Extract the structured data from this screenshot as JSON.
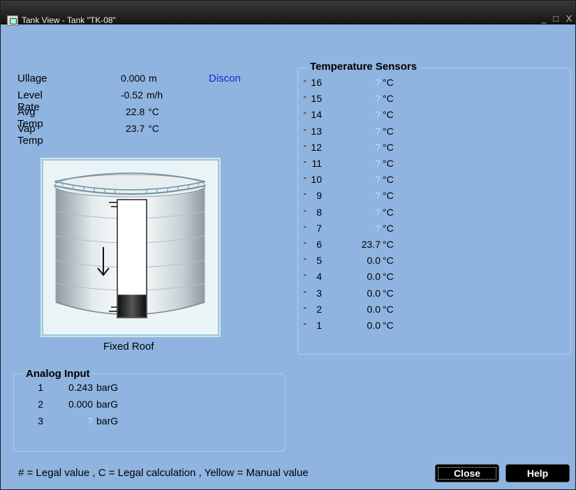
{
  "window": {
    "title": "Tank View - Tank \"TK-08\"",
    "controls": {
      "minimize": "_",
      "maximize": "□",
      "close": "X"
    }
  },
  "readouts": [
    {
      "label": "Ullage",
      "value": "0.000",
      "unit": "m"
    },
    {
      "label": "Level Rate",
      "value": "-0.52",
      "unit": "m/h"
    },
    {
      "label": "Avg Temp",
      "value": "22.8",
      "unit": "°C"
    },
    {
      "label": "Vap Temp",
      "value": "23.7",
      "unit": "°C"
    }
  ],
  "status": "Discon",
  "tank": {
    "roof_type": "Fixed Roof",
    "level_fraction": 0.19,
    "direction": "down"
  },
  "analog_input": {
    "title": "Analog Input",
    "rows": [
      {
        "index": "1",
        "value": "0.243",
        "unit": "barG"
      },
      {
        "index": "2",
        "value": "0.000",
        "unit": "barG"
      },
      {
        "index": "3",
        "value": "?",
        "unit": "barG"
      }
    ]
  },
  "temperature_sensors": {
    "title": "Temperature Sensors",
    "marker": "\"",
    "rows": [
      {
        "index": "16",
        "value": "?",
        "unit": "°C"
      },
      {
        "index": "15",
        "value": "?",
        "unit": "°C"
      },
      {
        "index": "14",
        "value": "?",
        "unit": "°C"
      },
      {
        "index": "13",
        "value": "?",
        "unit": "°C"
      },
      {
        "index": "12",
        "value": "?",
        "unit": "°C"
      },
      {
        "index": "11",
        "value": "?",
        "unit": "°C"
      },
      {
        "index": "10",
        "value": "?",
        "unit": "°C"
      },
      {
        "index": "9",
        "value": "?",
        "unit": "°C"
      },
      {
        "index": "8",
        "value": "?",
        "unit": "°C"
      },
      {
        "index": "7",
        "value": "?",
        "unit": "°C"
      },
      {
        "index": "6",
        "value": "23.7",
        "unit": "°C"
      },
      {
        "index": "5",
        "value": "0.0",
        "unit": "°C"
      },
      {
        "index": "4",
        "value": "0.0",
        "unit": "°C"
      },
      {
        "index": "3",
        "value": "0.0",
        "unit": "°C"
      },
      {
        "index": "2",
        "value": "0.0",
        "unit": "°C"
      },
      {
        "index": "1",
        "value": "0.0",
        "unit": "°C"
      }
    ]
  },
  "legend": "# = Legal value , C = Legal calculation , Yellow = Manual value",
  "buttons": {
    "close": "Close",
    "help": "Help"
  },
  "colors": {
    "background": "#8fb4e0",
    "status_text": "#0a2cd8",
    "unknown_value": "#c9dbf2",
    "button": "#000000"
  }
}
